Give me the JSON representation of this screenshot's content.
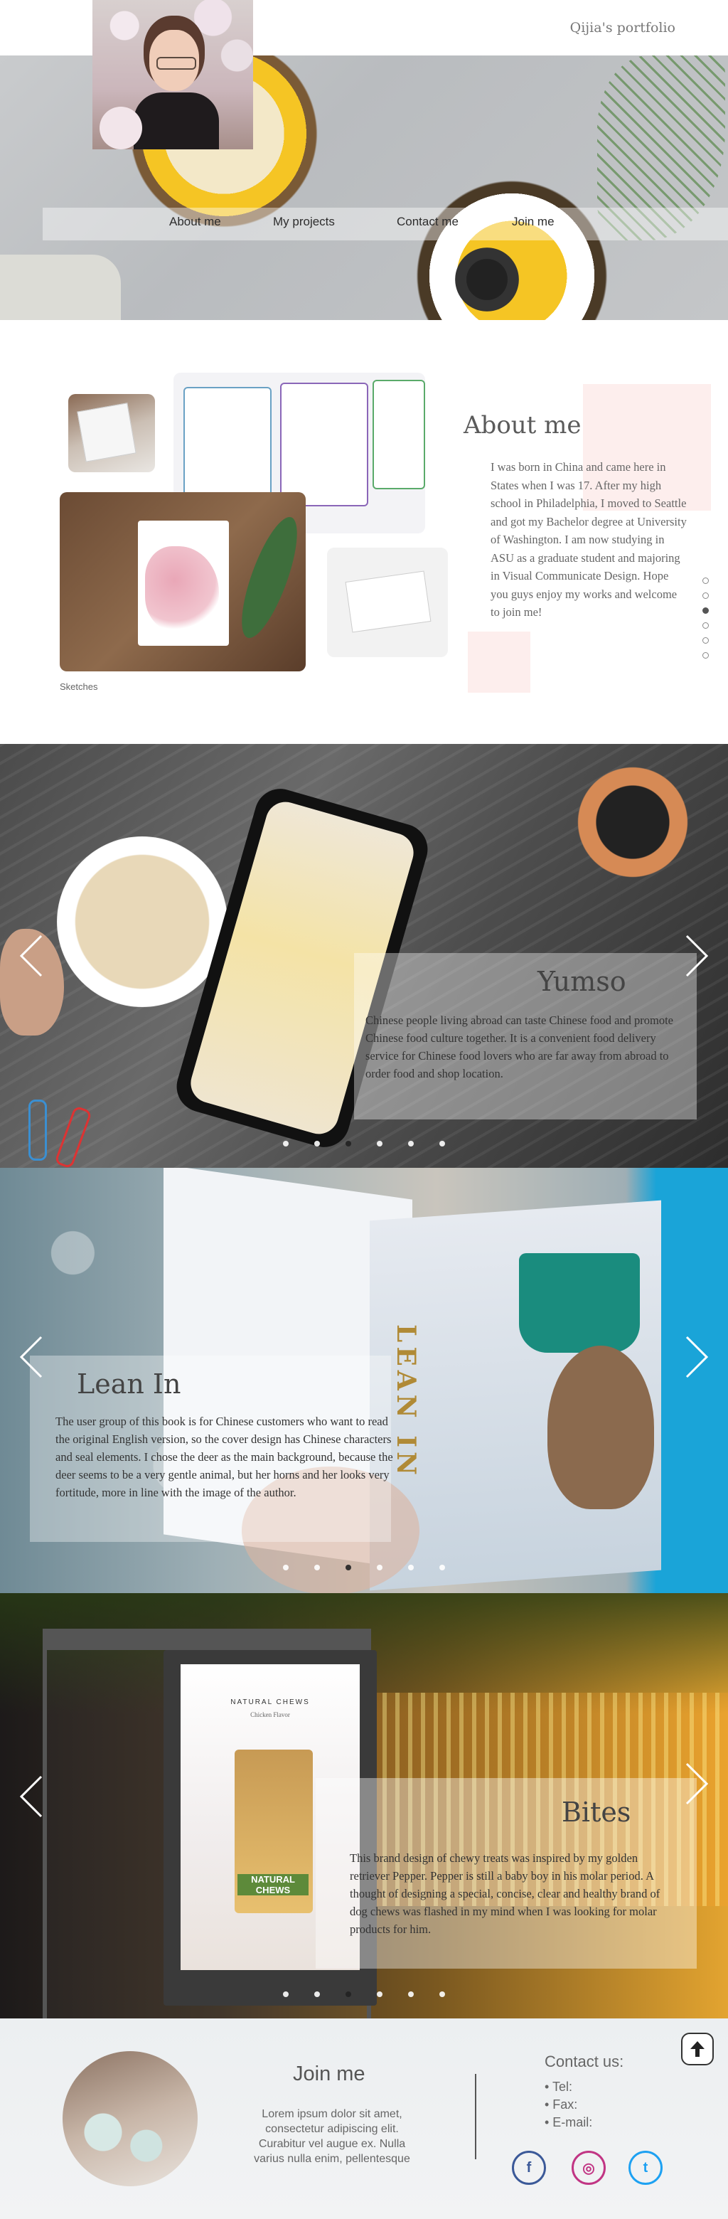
{
  "site": {
    "title": "Qijia's portfolio"
  },
  "nav": {
    "items": [
      {
        "label": "About me"
      },
      {
        "label": "My projects"
      },
      {
        "label": "Contact me"
      },
      {
        "label": "Join me"
      }
    ]
  },
  "about": {
    "title": "About me",
    "body": "I was born in China and came here in States when I was 17. After my high school in Philadelphia, I moved to Seattle and got my Bachelor degree at University of Washington. I am now studying in ASU as a graduate student and majoring in Visual Communicate Design. Hope you guys enjoy my works and welcome to join me!",
    "gallery_caption": "Sketches",
    "side_dots_count": 6,
    "side_dots_active": 2
  },
  "projects": [
    {
      "title": "Yumso",
      "body": "Chinese people living abroad can taste Chinese food and promote Chinese food culture together. It is a convenient food delivery service for Chinese food lovers who are far away from abroad to order food and shop location.",
      "dots_active": 2
    },
    {
      "title": "Lean In",
      "body": "The user group of this book is for Chinese customers who want to read the original English version, so the cover design has Chinese characters and seal elements. I chose the deer as the main background, because the deer seems to be a very gentle animal, but her horns and her looks very fortitude, more in line with the image of the author.",
      "cover_text": "LEAN IN",
      "dots_active": 2
    },
    {
      "title": "Bites",
      "body": "This brand design of chewy treats was inspired by my golden retriever Pepper. Pepper is still a baby boy in his molar period. A thought of designing a special, concise, clear and healthy brand of dog chews was flashed in my mind when I was looking for molar products for him.",
      "poster_title": "NATURAL CHEWS",
      "poster_sub": "Chicken Flavor",
      "bag_text": "NATURAL CHEWS",
      "dots_active": 2
    }
  ],
  "footer": {
    "join_title": "Join me",
    "join_body": "Lorem ipsum dolor sit amet, consectetur adipiscing elit. Curabitur vel augue ex. Nulla varius nulla enim, pellentesque",
    "contact_title": "Contact us:",
    "contact_items": [
      "• Tel:",
      "• Fax:",
      "• E-mail:"
    ],
    "social": [
      {
        "name": "facebook",
        "glyph": "f"
      },
      {
        "name": "instagram",
        "glyph": "◎"
      },
      {
        "name": "twitter",
        "glyph": "t"
      }
    ]
  },
  "colors": {
    "accent_pink": "#fdeeed",
    "text_gray": "#666666",
    "facebook": "#3b5998",
    "instagram": "#c13584",
    "twitter": "#1da1f2"
  }
}
